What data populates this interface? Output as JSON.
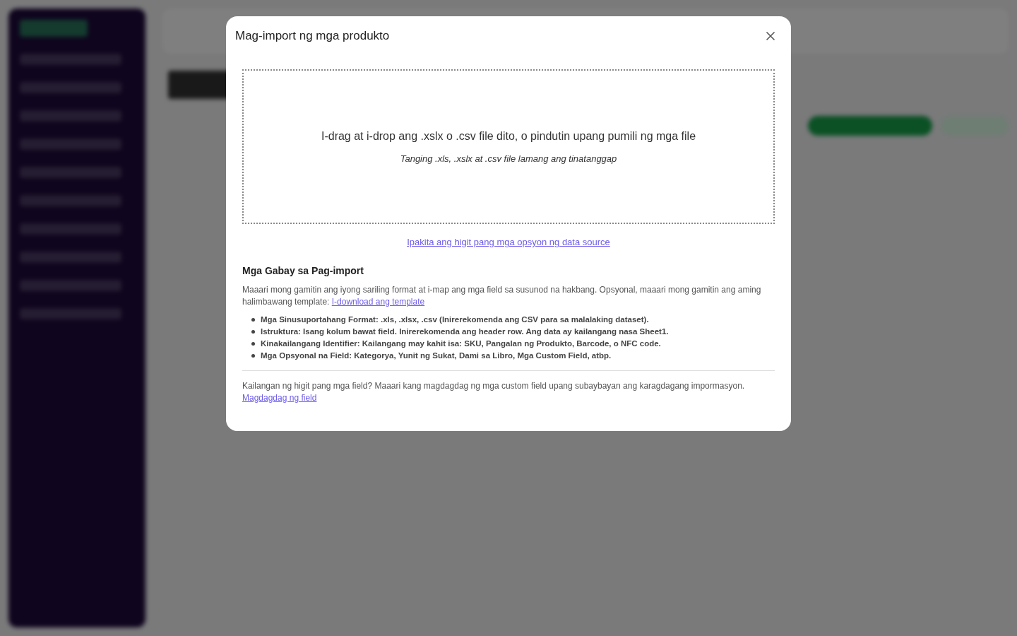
{
  "dialog": {
    "title": "Mag-import ng mga produkto",
    "dropzone": {
      "prompt": "I-drag at i-drop ang .xslx o .csv file dito, o pindutin upang pumili ng mga file",
      "hint": "Tanging .xls, .xslx at .csv file lamang ang tinatanggap"
    },
    "more_sources_link": "Ipakita ang higit pang mga opsyon ng data source",
    "guide": {
      "heading": "Mga Gabay sa Pag-import",
      "intro": "Maaari mong gamitin ang iyong sariling format at i-map ang mga field sa susunod na hakbang. Opsyonal, maaari mong gamitin ang aming halimbawang template:",
      "intro_link": "I-download ang template",
      "bullets": [
        "Mga Sinusuportahang Format: .xls, .xlsx, .csv (Inirerekomenda ang CSV para sa malalaking dataset).",
        "Istruktura: Isang kolum bawat field. Inirerekomenda ang header row. Ang data ay kailangang nasa Sheet1.",
        "Kinakailangang Identifier: Kailangang may kahit isa: SKU, Pangalan ng Produkto, Barcode, o NFC code.",
        "Mga Opsyonal na Field: Kategorya, Yunit ng Sukat, Dami sa Libro, Mga Custom Field, atbp."
      ]
    },
    "footer": {
      "text": "Kailangan ng higit pang mga field? Maaari kang magdagdag ng mga custom field upang subaybayan ang karagdagang impormasyon.",
      "link": "Magdagdag ng field"
    }
  }
}
